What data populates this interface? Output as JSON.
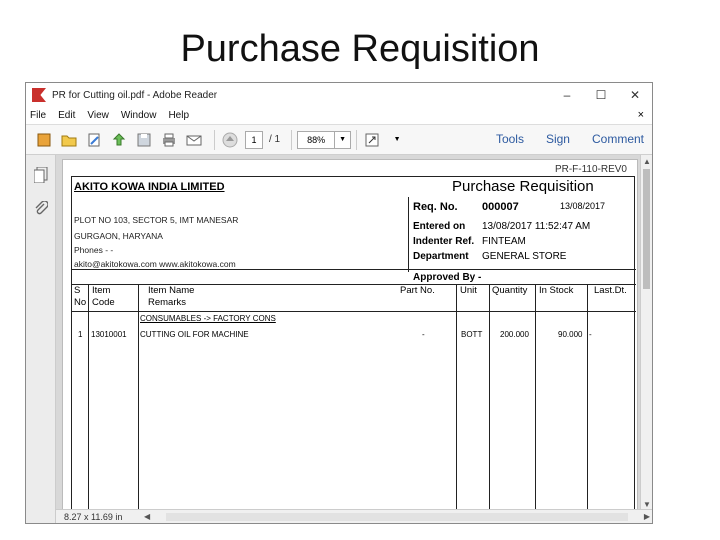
{
  "slide": {
    "title": "Purchase Requisition"
  },
  "window": {
    "title": "PR for Cutting oil.pdf - Adobe Reader",
    "controls": [
      "–",
      "☐",
      "✕"
    ]
  },
  "menu": {
    "items": [
      "File",
      "Edit",
      "View",
      "Window",
      "Help"
    ],
    "close": "×"
  },
  "toolbar": {
    "page_current": "1",
    "page_total": "/ 1",
    "zoom": "88%",
    "links": [
      "Tools",
      "Sign",
      "Comment"
    ]
  },
  "status": {
    "page_size": "8.27 x 11.69 in"
  },
  "document": {
    "doc_code": "PR-F-110-REV0",
    "company": "AKITO KOWA INDIA LIMITED",
    "address": [
      "PLOT NO 103, SECTOR 5, IMT MANESAR",
      "GURGAON, HARYANA",
      "Phones - -",
      "akito@akitokowa.com www.akitokowa.com"
    ],
    "title": "Purchase Requisition",
    "req_label": "Req. No.",
    "req_no": "000007",
    "req_date": "13/08/2017",
    "entered_label": "Entered on",
    "entered_on": "13/08/2017 11:52:47 AM",
    "indenter_label": "Indenter Ref.",
    "indenter": "FINTEAM",
    "dept_label": "Department",
    "dept": "GENERAL STORE",
    "approved_label": "Approved By -",
    "headers": {
      "sno_1": "S",
      "sno_2": "No",
      "code_1": "Item",
      "code_2": "Code",
      "name_1": "Item Name",
      "name_2": "Remarks",
      "part": "Part No.",
      "unit": "Unit",
      "qty": "Quantity",
      "stock": "In Stock",
      "last": "Last.Dt."
    },
    "category": "CONSUMABLES -> FACTORY CONS",
    "row": {
      "sno": "1",
      "code": "13010001",
      "name": "CUTTING OIL FOR MACHINE",
      "part": "-",
      "unit": "BOTT",
      "qty": "200.000",
      "stock": "90.000",
      "last": "-"
    }
  }
}
